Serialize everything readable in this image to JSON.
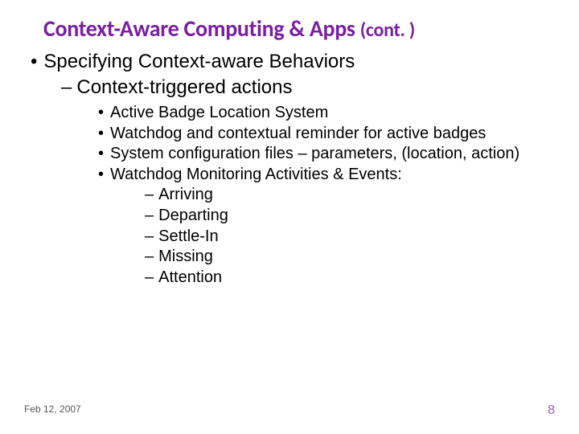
{
  "title_main": "Context-Aware Computing & Apps ",
  "title_cont": "(cont. )",
  "l1_a": "Specifying Context-aware Behaviors",
  "l2_a": "Context-triggered actions",
  "l3_a": "Active Badge Location System",
  "l3_b": "Watchdog and contextual reminder for active badges",
  "l3_c": "System configuration files – parameters, (location, action)",
  "l3_d": "Watchdog Monitoring Activities & Events:",
  "l4_a": "Arriving",
  "l4_b": "Departing",
  "l4_c": "Settle-In",
  "l4_d": "Missing",
  "l4_e": "Attention",
  "footer_date": "Feb 12, 2007",
  "footer_page": "8"
}
